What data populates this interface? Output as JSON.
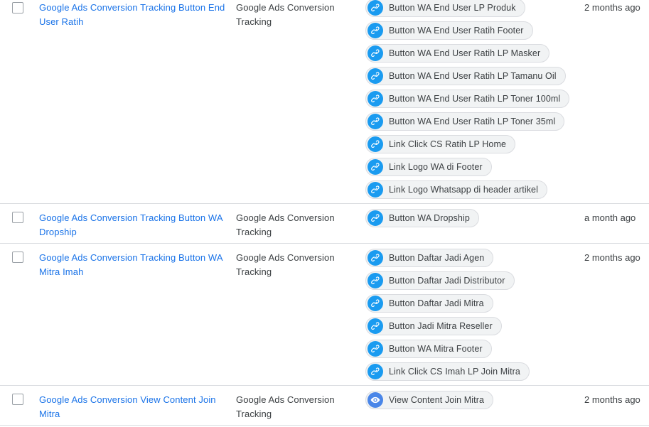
{
  "rows": [
    {
      "name": "Google Ads Conversion Tracking Button End User Ratih",
      "type": "Google Ads Conversion Tracking",
      "time": "2 months ago",
      "triggers": [
        "Button WA End User LP Produk",
        "Button WA End User Ratih Footer",
        "Button WA End User Ratih LP Masker",
        "Button WA End User Ratih LP Tamanu Oil",
        "Button WA End User Ratih LP Toner 100ml",
        "Button WA End User Ratih LP Toner 35ml",
        "Link Click CS Ratih LP Home",
        "Link Logo WA di Footer",
        "Link Logo Whatsapp di header artikel"
      ]
    },
    {
      "name": "Google Ads Conversion Tracking Button WA Dropship",
      "type": "Google Ads Conversion Tracking",
      "time": "a month ago",
      "triggers": [
        "Button WA Dropship"
      ]
    },
    {
      "name": "Google Ads Conversion Tracking Button WA Mitra Imah",
      "type": "Google Ads Conversion Tracking",
      "time": "2 months ago",
      "triggers": [
        "Button Daftar Jadi Agen",
        "Button Daftar Jadi Distributor",
        "Button Daftar Jadi Mitra",
        "Button Jadi Mitra Reseller",
        "Button WA Mitra Footer",
        "Link Click CS Imah LP Join Mitra"
      ]
    },
    {
      "name": "Google Ads Conversion View Content Join Mitra",
      "type": "Google Ads Conversion Tracking",
      "time": "2 months ago",
      "triggers": [
        "View Content Join Mitra"
      ]
    }
  ],
  "icons": {
    "link_trigger": "link-icon",
    "view_trigger": "eye-icon",
    "link_color": "#1a9bf0",
    "view_color": "#4a86e8"
  }
}
